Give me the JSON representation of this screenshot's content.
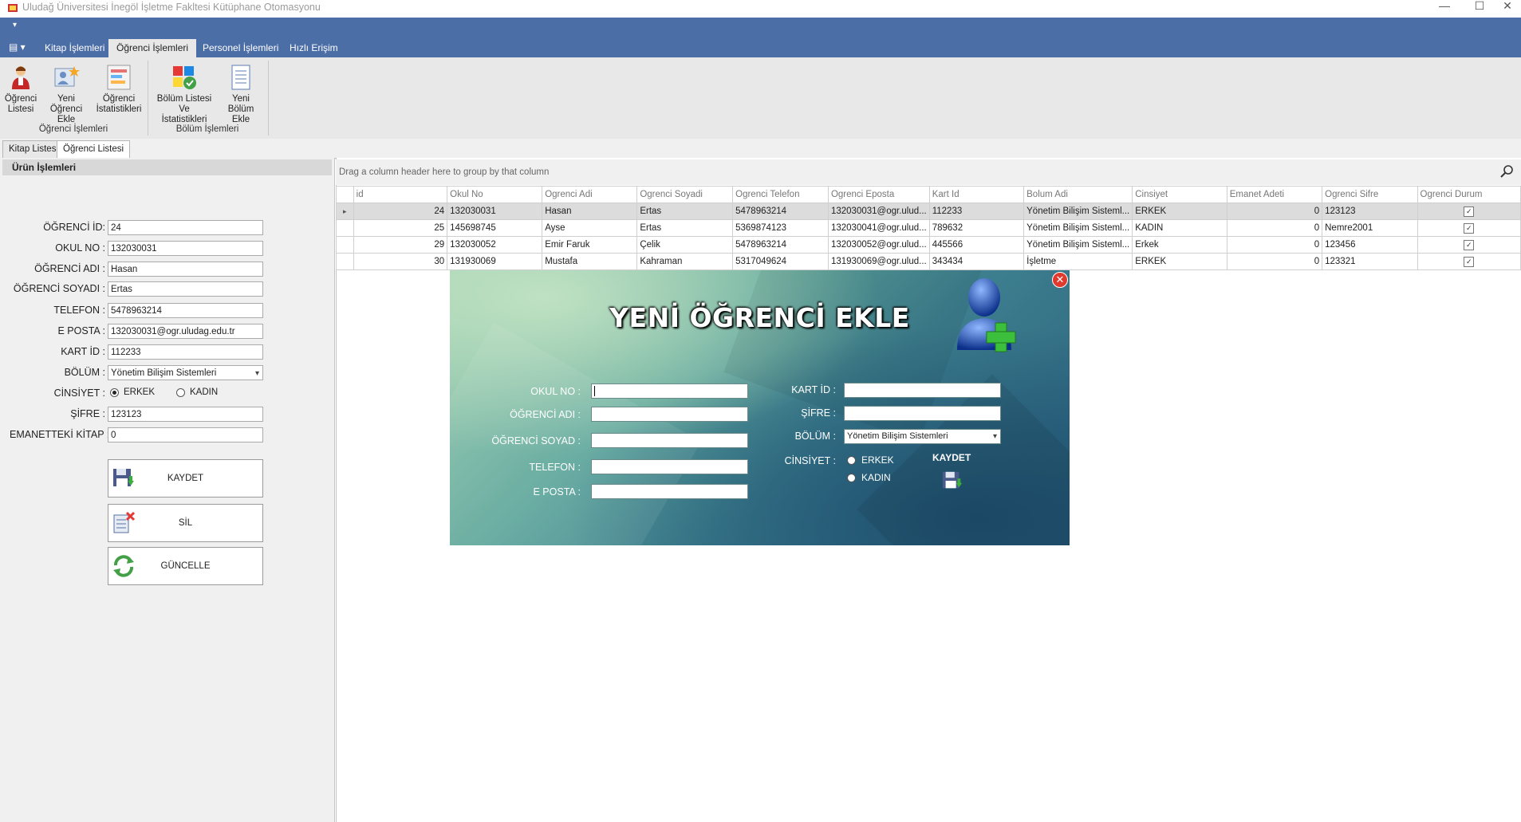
{
  "window": {
    "title": "Uludağ Üniversitesi İnegöl İşletme Fakltesi Kütüphane Otomasyonu",
    "minimize": "—",
    "maximize": "☐",
    "close": "✕"
  },
  "ribbon": {
    "app_menu": "▤ ▾",
    "quick_access": "▾",
    "tabs": [
      "Kitap İşlemleri",
      "Öğrenci İşlemleri",
      "Personel İşlemleri",
      "Hızlı Erişim"
    ],
    "active_tab": "Öğrenci İşlemleri",
    "groups": [
      {
        "label": "Öğrenci İşlemleri",
        "buttons": [
          {
            "line1": "Öğrenci",
            "line2": "Listesi",
            "icon": "student-list-icon"
          },
          {
            "line1": "Yeni Öğrenci",
            "line2": "Ekle",
            "icon": "add-student-icon"
          },
          {
            "line1": "Öğrenci",
            "line2": "İstatistikleri",
            "icon": "statistics-icon"
          }
        ]
      },
      {
        "label": "Bölüm İşlemleri",
        "buttons": [
          {
            "line1": "Bölüm Listesi Ve",
            "line2": "İstatistikleri",
            "icon": "department-stats-icon"
          },
          {
            "line1": "Yeni Bölüm",
            "line2": "Ekle",
            "icon": "add-department-icon"
          }
        ]
      }
    ]
  },
  "doc_tabs": [
    "Kitap Listesi",
    "Öğrenci Listesi"
  ],
  "active_doc_tab": "Öğrenci Listesi",
  "left_panel": {
    "header": "Ürün İşlemleri",
    "fields": {
      "ogrenci_id": {
        "label": "ÖĞRENCİ İD:",
        "value": "24"
      },
      "okul_no": {
        "label": "OKUL NO :",
        "value": "132030031"
      },
      "ogrenci_adi": {
        "label": "ÖĞRENCİ ADI :",
        "value": "Hasan"
      },
      "ogrenci_soyadi": {
        "label": "ÖĞRENCİ SOYADI :",
        "value": "Ertas"
      },
      "telefon": {
        "label": "TELEFON :",
        "value": "5478963214"
      },
      "e_posta": {
        "label": "E POSTA :",
        "value": "132030031@ogr.uludag.edu.tr"
      },
      "kart_id": {
        "label": "KART İD :",
        "value": "112233"
      },
      "bolum": {
        "label": "BÖLÜM :",
        "value": "Yönetim Bilişim Sistemleri"
      },
      "cinsiyet": {
        "label": "CİNSİYET :",
        "option1": "ERKEK",
        "option2": "KADIN",
        "selected": "ERKEK"
      },
      "sifre": {
        "label": "ŞİFRE :",
        "value": "123123"
      },
      "emanetteki_kitap": {
        "label": "EMANETTEKİ KİTAP :",
        "value": "0"
      }
    },
    "buttons": {
      "save": "KAYDET",
      "delete": "SİL",
      "update": "GÜNCELLE"
    }
  },
  "grid": {
    "group_hint": "Drag a column header here to group by that column",
    "columns": [
      "id",
      "Okul No",
      "Ogrenci Adi",
      "Ogrenci Soyadi",
      "Ogrenci Telefon",
      "Ogrenci Eposta",
      "Kart Id",
      "Bolum Adi",
      "Cinsiyet",
      "Emanet Adeti",
      "Ogrenci Sifre",
      "Ogrenci Durum"
    ],
    "rows": [
      {
        "id": "24",
        "okul_no": "132030031",
        "adi": "Hasan",
        "soyadi": "Ertas",
        "telefon": "5478963214",
        "eposta": "132030031@ogr.ulud...",
        "kart_id": "112233",
        "bolum": "Yönetim Bilişim Sisteml...",
        "cinsiyet": "ERKEK",
        "emanet": "0",
        "sifre": "123123",
        "durum": true
      },
      {
        "id": "25",
        "okul_no": "145698745",
        "adi": "Ayse",
        "soyadi": "Ertas",
        "telefon": "5369874123",
        "eposta": "132030041@ogr.ulud...",
        "kart_id": "789632",
        "bolum": "Yönetim Bilişim Sisteml...",
        "cinsiyet": "KADIN",
        "emanet": "0",
        "sifre": "Nemre2001",
        "durum": true
      },
      {
        "id": "29",
        "okul_no": "132030052",
        "adi": "Emir Faruk",
        "soyadi": "Çelik",
        "telefon": "5478963214",
        "eposta": "132030052@ogr.ulud...",
        "kart_id": "445566",
        "bolum": "Yönetim Bilişim Sisteml...",
        "cinsiyet": "Erkek",
        "emanet": "0",
        "sifre": "123456",
        "durum": true
      },
      {
        "id": "30",
        "okul_no": "131930069",
        "adi": "Mustafa",
        "soyadi": "Kahraman",
        "telefon": "5317049624",
        "eposta": "131930069@ogr.ulud...",
        "kart_id": "343434",
        "bolum": "İşletme",
        "cinsiyet": "ERKEK",
        "emanet": "0",
        "sifre": "123321",
        "durum": true
      }
    ]
  },
  "dialog": {
    "title": "YENİ ÖĞRENCİ EKLE",
    "close": "✕",
    "okul_no_label": "OKUL NO :",
    "ogrenci_adi_label": "ÖĞRENCİ ADI :",
    "ogrenci_soyad_label": "ÖĞRENCİ SOYAD :",
    "telefon_label": "TELEFON :",
    "e_posta_label": "E POSTA :",
    "kart_id_label": "KART İD :",
    "sifre_label": "ŞİFRE :",
    "bolum_label": "BÖLÜM :",
    "bolum_value": "Yönetim Bilişim Sistemleri",
    "cinsiyet_label": "CİNSİYET :",
    "erkek": "ERKEK",
    "kadin": "KADIN",
    "kaydet": "KAYDET"
  },
  "colors": {
    "ribbon_blue": "#4c6ea6",
    "accent_red": "#e03a2f",
    "plus_green": "#3cbf3c"
  }
}
